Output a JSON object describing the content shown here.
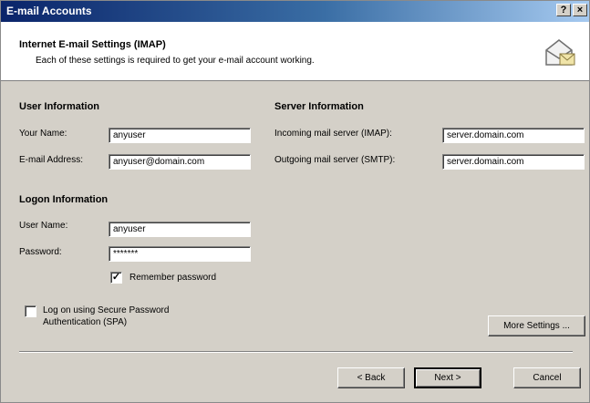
{
  "window": {
    "title": "E-mail Accounts",
    "help_label": "?",
    "close_label": "×"
  },
  "header": {
    "title": "Internet E-mail Settings (IMAP)",
    "subtitle": "Each of these settings is required to get your e-mail account working.",
    "icon": "envelope-icon"
  },
  "user_info": {
    "section_title": "User Information",
    "name_label": "Your Name:",
    "name_value": "anyuser",
    "email_label": "E-mail Address:",
    "email_value": "anyuser@domain.com"
  },
  "server_info": {
    "section_title": "Server Information",
    "incoming_label": "Incoming mail server (IMAP):",
    "incoming_value": "server.domain.com",
    "outgoing_label": "Outgoing mail server (SMTP):",
    "outgoing_value": "server.domain.com"
  },
  "logon_info": {
    "section_title": "Logon Information",
    "username_label": "User Name:",
    "username_value": "anyuser",
    "password_label": "Password:",
    "password_value": "*******",
    "remember_label": "Remember password",
    "remember_checked": true
  },
  "spa": {
    "label_line1": "Log on using Secure Password",
    "label_line2": "Authentication (SPA)",
    "checked": false
  },
  "buttons": {
    "more_settings": "More Settings ...",
    "back": "< Back",
    "next": "Next >",
    "cancel": "Cancel"
  },
  "colors": {
    "titlebar_start": "#0a246a",
    "titlebar_end": "#a6caf0",
    "dialog_bg": "#d4d0c8"
  }
}
